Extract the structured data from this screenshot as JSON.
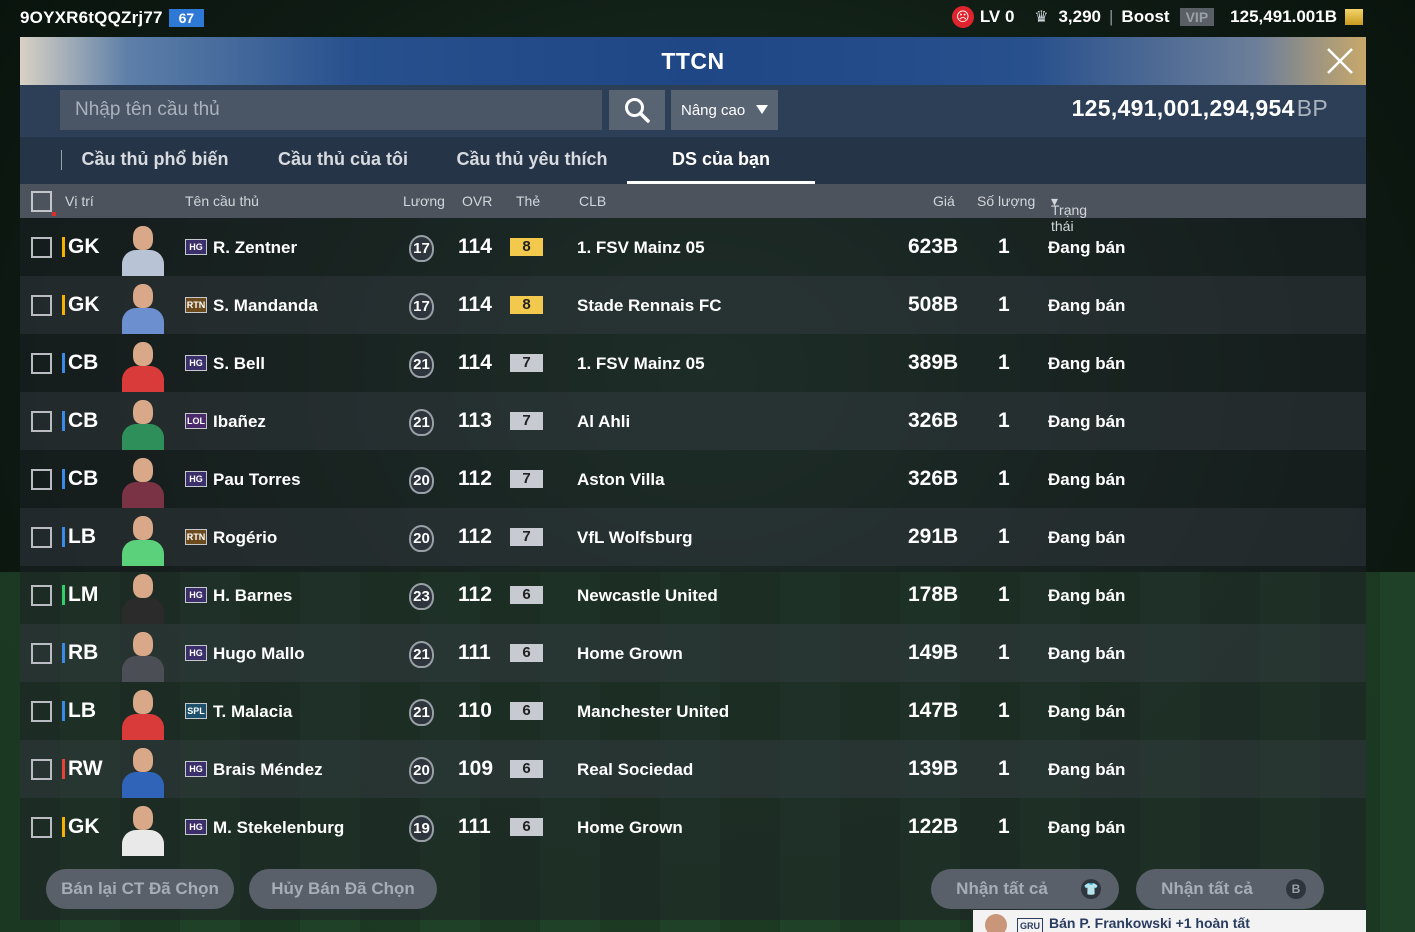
{
  "topbar": {
    "user_id": "9OYXR6tQQZrj77",
    "user_level": "67",
    "lv_label": "LV 0",
    "trophies": "3,290",
    "boost_label": "Boost",
    "vip_label": "VIP",
    "bp_balance": "125,491.001B"
  },
  "window": {
    "title": "TTCN",
    "close_glyph": "✕"
  },
  "search": {
    "placeholder": "Nhập tên cầu thủ",
    "advanced_label": "Nâng cao",
    "bp_amount": "125,491,001,294,954",
    "bp_unit": "BP"
  },
  "tabs": [
    {
      "label": "Cầu thủ phổ biến"
    },
    {
      "label": "Cầu thủ của tôi"
    },
    {
      "label": "Cầu thủ yêu thích"
    },
    {
      "label": "DS của bạn"
    }
  ],
  "columns": {
    "position": "Vị trí",
    "name": "Tên cầu thủ",
    "salary": "Lương",
    "ovr": "OVR",
    "grade": "Thẻ",
    "club": "CLB",
    "price": "Giá",
    "quantity": "Số lượng",
    "status": "Trạng thái"
  },
  "players": [
    {
      "position": "GK",
      "season": "HG",
      "name": "R. Zentner",
      "salary": "17",
      "ovr": "114",
      "grade": "8",
      "club": "1. FSV Mainz 05",
      "price": "623B",
      "qty": "1",
      "status": "Đang bán"
    },
    {
      "position": "GK",
      "season": "RTN",
      "name": "S. Mandanda",
      "salary": "17",
      "ovr": "114",
      "grade": "8",
      "club": "Stade Rennais FC",
      "price": "508B",
      "qty": "1",
      "status": "Đang bán"
    },
    {
      "position": "CB",
      "season": "HG",
      "name": "S. Bell",
      "salary": "21",
      "ovr": "114",
      "grade": "7",
      "club": "1. FSV Mainz 05",
      "price": "389B",
      "qty": "1",
      "status": "Đang bán"
    },
    {
      "position": "CB",
      "season": "LOL",
      "name": "Ibañez",
      "salary": "21",
      "ovr": "113",
      "grade": "7",
      "club": "Al Ahli",
      "price": "326B",
      "qty": "1",
      "status": "Đang bán"
    },
    {
      "position": "CB",
      "season": "HG",
      "name": "Pau Torres",
      "salary": "20",
      "ovr": "112",
      "grade": "7",
      "club": "Aston Villa",
      "price": "326B",
      "qty": "1",
      "status": "Đang bán"
    },
    {
      "position": "LB",
      "season": "RTN",
      "name": "Rogério",
      "salary": "20",
      "ovr": "112",
      "grade": "7",
      "club": "VfL Wolfsburg",
      "price": "291B",
      "qty": "1",
      "status": "Đang bán"
    },
    {
      "position": "LM",
      "season": "HG",
      "name": "H. Barnes",
      "salary": "23",
      "ovr": "112",
      "grade": "6",
      "club": "Newcastle United",
      "price": "178B",
      "qty": "1",
      "status": "Đang bán"
    },
    {
      "position": "RB",
      "season": "HG",
      "name": "Hugo Mallo",
      "salary": "21",
      "ovr": "111",
      "grade": "6",
      "club": "Home Grown",
      "price": "149B",
      "qty": "1",
      "status": "Đang bán"
    },
    {
      "position": "LB",
      "season": "SPL",
      "name": "T. Malacia",
      "salary": "21",
      "ovr": "110",
      "grade": "6",
      "club": "Manchester United",
      "price": "147B",
      "qty": "1",
      "status": "Đang bán"
    },
    {
      "position": "RW",
      "season": "HG",
      "name": "Brais Méndez",
      "salary": "20",
      "ovr": "109",
      "grade": "6",
      "club": "Real Sociedad",
      "price": "139B",
      "qty": "1",
      "status": "Đang bán"
    },
    {
      "position": "GK",
      "season": "HG",
      "name": "M. Stekelenburg",
      "salary": "19",
      "ovr": "111",
      "grade": "6",
      "club": "Home Grown",
      "price": "122B",
      "qty": "1",
      "status": "Đang bán"
    }
  ],
  "footer": {
    "resell_label": "Bán lại CT Đã Chọn",
    "cancel_label": "Hủy Bán Đã Chọn",
    "collect_all_1": "Nhận tất cả",
    "collect_all_2": "Nhận tất cả"
  },
  "toast": {
    "tag": "GRU",
    "text": "Bán P. Frankowski +1 hoàn tất"
  },
  "colors": {
    "gk": "#f5b300",
    "def": "#3a8be8",
    "mid": "#2fcf6a",
    "att": "#e8413a",
    "grade8": "#f2c94c",
    "grade7": "#c7cbd1",
    "grade6": "#c7cbd1"
  }
}
